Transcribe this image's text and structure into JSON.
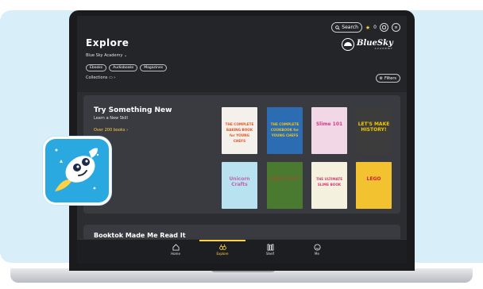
{
  "header": {
    "search_label": "Search",
    "star_count": "0",
    "page_title": "Explore",
    "library_name": "Blue Sky Academy",
    "format_filters": [
      "Ebooks",
      "Audiobooks",
      "Magazines"
    ],
    "collections_label": "Collections",
    "filters_label": "Filters"
  },
  "logo": {
    "name": "BlueSky",
    "tagline": "ACADEMY"
  },
  "featured": {
    "title": "Try Something New",
    "subtitle": "Learn a New Skill",
    "link": "Over 200 books",
    "books": [
      {
        "title": "THE COMPLETE BAKING BOOK for YOUNG CHEFS",
        "color": "#f4f1ec",
        "accent": "#e5531f"
      },
      {
        "title": "THE COMPLETE COOKBOOK for YOUNG CHEFS",
        "color": "#2b6cb3",
        "accent": "#f0c419"
      },
      {
        "title": "Slime 101",
        "color": "#f2d7e6",
        "accent": "#d43d8c"
      },
      {
        "title": "LET'S MAKE HISTORY!",
        "color": "#3c3c3c",
        "accent": "#f2c800"
      },
      {
        "title": "Unicorn Crafts",
        "color": "#b9e2f0",
        "accent": "#c063b0"
      },
      {
        "title": "MINECRAFT",
        "color": "#4a7a2f",
        "accent": "#8b5a2b"
      },
      {
        "title": "THE ULTIMATE SLIME BOOK",
        "color": "#f5f1df",
        "accent": "#d23a7a"
      },
      {
        "title": "LEGO",
        "color": "#f2c230",
        "accent": "#d1202d"
      }
    ]
  },
  "section2": {
    "title": "Booktok Made Me Read It"
  },
  "tabs": [
    {
      "label": "Home",
      "icon": "home-icon"
    },
    {
      "label": "Explore",
      "icon": "explore-icon",
      "active": true
    },
    {
      "label": "Shelf",
      "icon": "shelf-icon"
    },
    {
      "label": "Me",
      "icon": "profile-icon"
    }
  ],
  "colors": {
    "accent": "#ffd23f",
    "background": "#2c2d31",
    "brand_blue": "#2aa8e0"
  }
}
